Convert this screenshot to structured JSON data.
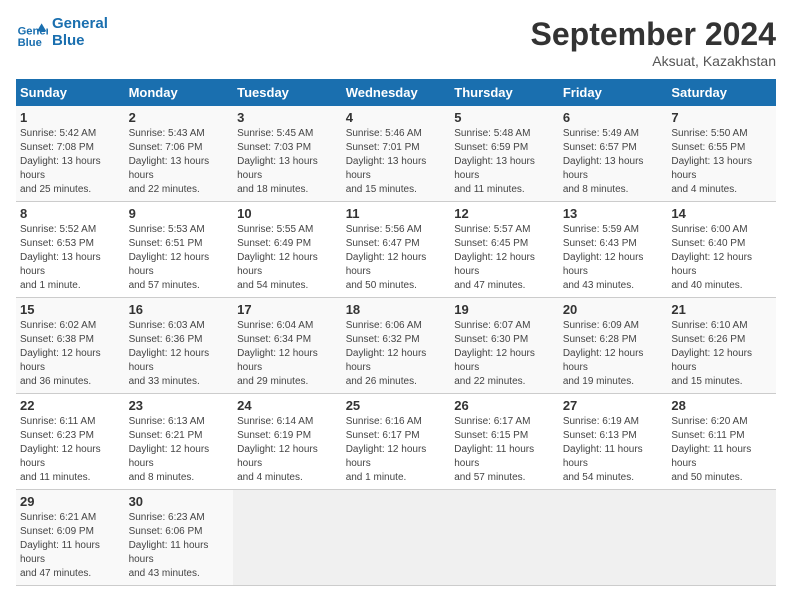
{
  "header": {
    "logo_line1": "General",
    "logo_line2": "Blue",
    "month": "September 2024",
    "location": "Aksuat, Kazakhstan"
  },
  "days_of_week": [
    "Sunday",
    "Monday",
    "Tuesday",
    "Wednesday",
    "Thursday",
    "Friday",
    "Saturday"
  ],
  "weeks": [
    [
      {
        "day": "1",
        "sunrise": "5:42 AM",
        "sunset": "7:08 PM",
        "daylight": "13 hours and 25 minutes."
      },
      {
        "day": "2",
        "sunrise": "5:43 AM",
        "sunset": "7:06 PM",
        "daylight": "13 hours and 22 minutes."
      },
      {
        "day": "3",
        "sunrise": "5:45 AM",
        "sunset": "7:03 PM",
        "daylight": "13 hours and 18 minutes."
      },
      {
        "day": "4",
        "sunrise": "5:46 AM",
        "sunset": "7:01 PM",
        "daylight": "13 hours and 15 minutes."
      },
      {
        "day": "5",
        "sunrise": "5:48 AM",
        "sunset": "6:59 PM",
        "daylight": "13 hours and 11 minutes."
      },
      {
        "day": "6",
        "sunrise": "5:49 AM",
        "sunset": "6:57 PM",
        "daylight": "13 hours and 8 minutes."
      },
      {
        "day": "7",
        "sunrise": "5:50 AM",
        "sunset": "6:55 PM",
        "daylight": "13 hours and 4 minutes."
      }
    ],
    [
      {
        "day": "8",
        "sunrise": "5:52 AM",
        "sunset": "6:53 PM",
        "daylight": "13 hours and 1 minute."
      },
      {
        "day": "9",
        "sunrise": "5:53 AM",
        "sunset": "6:51 PM",
        "daylight": "12 hours and 57 minutes."
      },
      {
        "day": "10",
        "sunrise": "5:55 AM",
        "sunset": "6:49 PM",
        "daylight": "12 hours and 54 minutes."
      },
      {
        "day": "11",
        "sunrise": "5:56 AM",
        "sunset": "6:47 PM",
        "daylight": "12 hours and 50 minutes."
      },
      {
        "day": "12",
        "sunrise": "5:57 AM",
        "sunset": "6:45 PM",
        "daylight": "12 hours and 47 minutes."
      },
      {
        "day": "13",
        "sunrise": "5:59 AM",
        "sunset": "6:43 PM",
        "daylight": "12 hours and 43 minutes."
      },
      {
        "day": "14",
        "sunrise": "6:00 AM",
        "sunset": "6:40 PM",
        "daylight": "12 hours and 40 minutes."
      }
    ],
    [
      {
        "day": "15",
        "sunrise": "6:02 AM",
        "sunset": "6:38 PM",
        "daylight": "12 hours and 36 minutes."
      },
      {
        "day": "16",
        "sunrise": "6:03 AM",
        "sunset": "6:36 PM",
        "daylight": "12 hours and 33 minutes."
      },
      {
        "day": "17",
        "sunrise": "6:04 AM",
        "sunset": "6:34 PM",
        "daylight": "12 hours and 29 minutes."
      },
      {
        "day": "18",
        "sunrise": "6:06 AM",
        "sunset": "6:32 PM",
        "daylight": "12 hours and 26 minutes."
      },
      {
        "day": "19",
        "sunrise": "6:07 AM",
        "sunset": "6:30 PM",
        "daylight": "12 hours and 22 minutes."
      },
      {
        "day": "20",
        "sunrise": "6:09 AM",
        "sunset": "6:28 PM",
        "daylight": "12 hours and 19 minutes."
      },
      {
        "day": "21",
        "sunrise": "6:10 AM",
        "sunset": "6:26 PM",
        "daylight": "12 hours and 15 minutes."
      }
    ],
    [
      {
        "day": "22",
        "sunrise": "6:11 AM",
        "sunset": "6:23 PM",
        "daylight": "12 hours and 11 minutes."
      },
      {
        "day": "23",
        "sunrise": "6:13 AM",
        "sunset": "6:21 PM",
        "daylight": "12 hours and 8 minutes."
      },
      {
        "day": "24",
        "sunrise": "6:14 AM",
        "sunset": "6:19 PM",
        "daylight": "12 hours and 4 minutes."
      },
      {
        "day": "25",
        "sunrise": "6:16 AM",
        "sunset": "6:17 PM",
        "daylight": "12 hours and 1 minute."
      },
      {
        "day": "26",
        "sunrise": "6:17 AM",
        "sunset": "6:15 PM",
        "daylight": "11 hours and 57 minutes."
      },
      {
        "day": "27",
        "sunrise": "6:19 AM",
        "sunset": "6:13 PM",
        "daylight": "11 hours and 54 minutes."
      },
      {
        "day": "28",
        "sunrise": "6:20 AM",
        "sunset": "6:11 PM",
        "daylight": "11 hours and 50 minutes."
      }
    ],
    [
      {
        "day": "29",
        "sunrise": "6:21 AM",
        "sunset": "6:09 PM",
        "daylight": "11 hours and 47 minutes."
      },
      {
        "day": "30",
        "sunrise": "6:23 AM",
        "sunset": "6:06 PM",
        "daylight": "11 hours and 43 minutes."
      },
      null,
      null,
      null,
      null,
      null
    ]
  ]
}
